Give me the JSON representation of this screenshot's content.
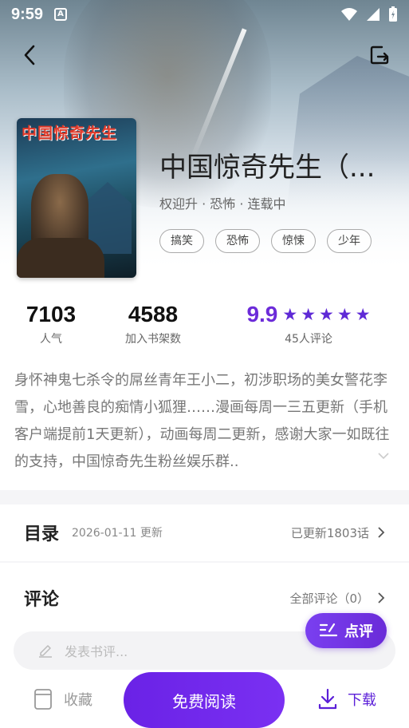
{
  "status_bar": {
    "time": "9:59",
    "app_badge": "A"
  },
  "book": {
    "title": "中国惊奇先生（...",
    "cover_title": "中国惊奇先生",
    "cover_badge": "中国",
    "meta": "权迎升 · 恐怖 · 连载中",
    "tags": [
      "搞笑",
      "恐怖",
      "惊悚",
      "少年"
    ]
  },
  "stats": {
    "popularity_value": "7103",
    "popularity_label": "人气",
    "shelf_value": "4588",
    "shelf_label": "加入书架数",
    "score_value": "9.9",
    "score_label": "45人评论",
    "stars": 5
  },
  "description": "身怀神鬼七杀令的屌丝青年王小二，初涉职场的美女警花李雪，心地善良的痴情小狐狸……漫画每周一三五更新（手机客户端提前1天更新），动画每周二更新，感谢大家一如既往的支持，中国惊奇先生粉丝娱乐群..",
  "catalog": {
    "title": "目录",
    "date": "2026-01-11 更新",
    "updated": "已更新1803话"
  },
  "comments": {
    "title": "评论",
    "all": "全部评论（0）",
    "placeholder": "发表书评..."
  },
  "float_button": {
    "label": "点评"
  },
  "bottom_bar": {
    "favorite": "收藏",
    "read": "免费阅读",
    "download": "下载"
  },
  "colors": {
    "accent": "#6a22e6",
    "star": "#5f2ad6"
  }
}
